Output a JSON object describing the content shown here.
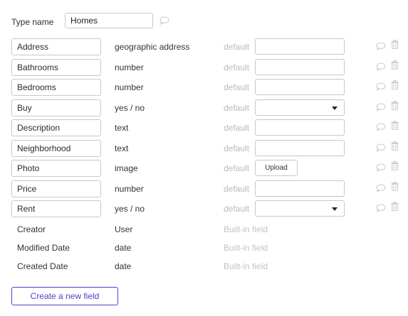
{
  "type_section": {
    "label": "Type name",
    "value": "Homes"
  },
  "default_label": "default",
  "upload_label": "Upload",
  "fields": [
    {
      "name": "Address",
      "type": "geographic address",
      "control": "text"
    },
    {
      "name": "Bathrooms",
      "type": "number",
      "control": "text"
    },
    {
      "name": "Bedrooms",
      "type": "number",
      "control": "text"
    },
    {
      "name": "Buy",
      "type": "yes / no",
      "control": "select"
    },
    {
      "name": "Description",
      "type": "text",
      "control": "text"
    },
    {
      "name": "Neighborhood",
      "type": "text",
      "control": "text"
    },
    {
      "name": "Photo",
      "type": "image",
      "control": "upload"
    },
    {
      "name": "Price",
      "type": "number",
      "control": "text"
    },
    {
      "name": "Rent",
      "type": "yes / no",
      "control": "select"
    }
  ],
  "builtin_fields": [
    {
      "name": "Creator",
      "type": "User",
      "note": "Built-in field"
    },
    {
      "name": "Modified Date",
      "type": "date",
      "note": "Built-in field"
    },
    {
      "name": "Created Date",
      "type": "date",
      "note": "Built-in field"
    }
  ],
  "create_button_label": "Create a new field",
  "colors": {
    "accent": "#5b3cc4",
    "muted_text": "#b9b9b9",
    "border": "#c8c8c8",
    "icon": "#c9c9c9"
  }
}
